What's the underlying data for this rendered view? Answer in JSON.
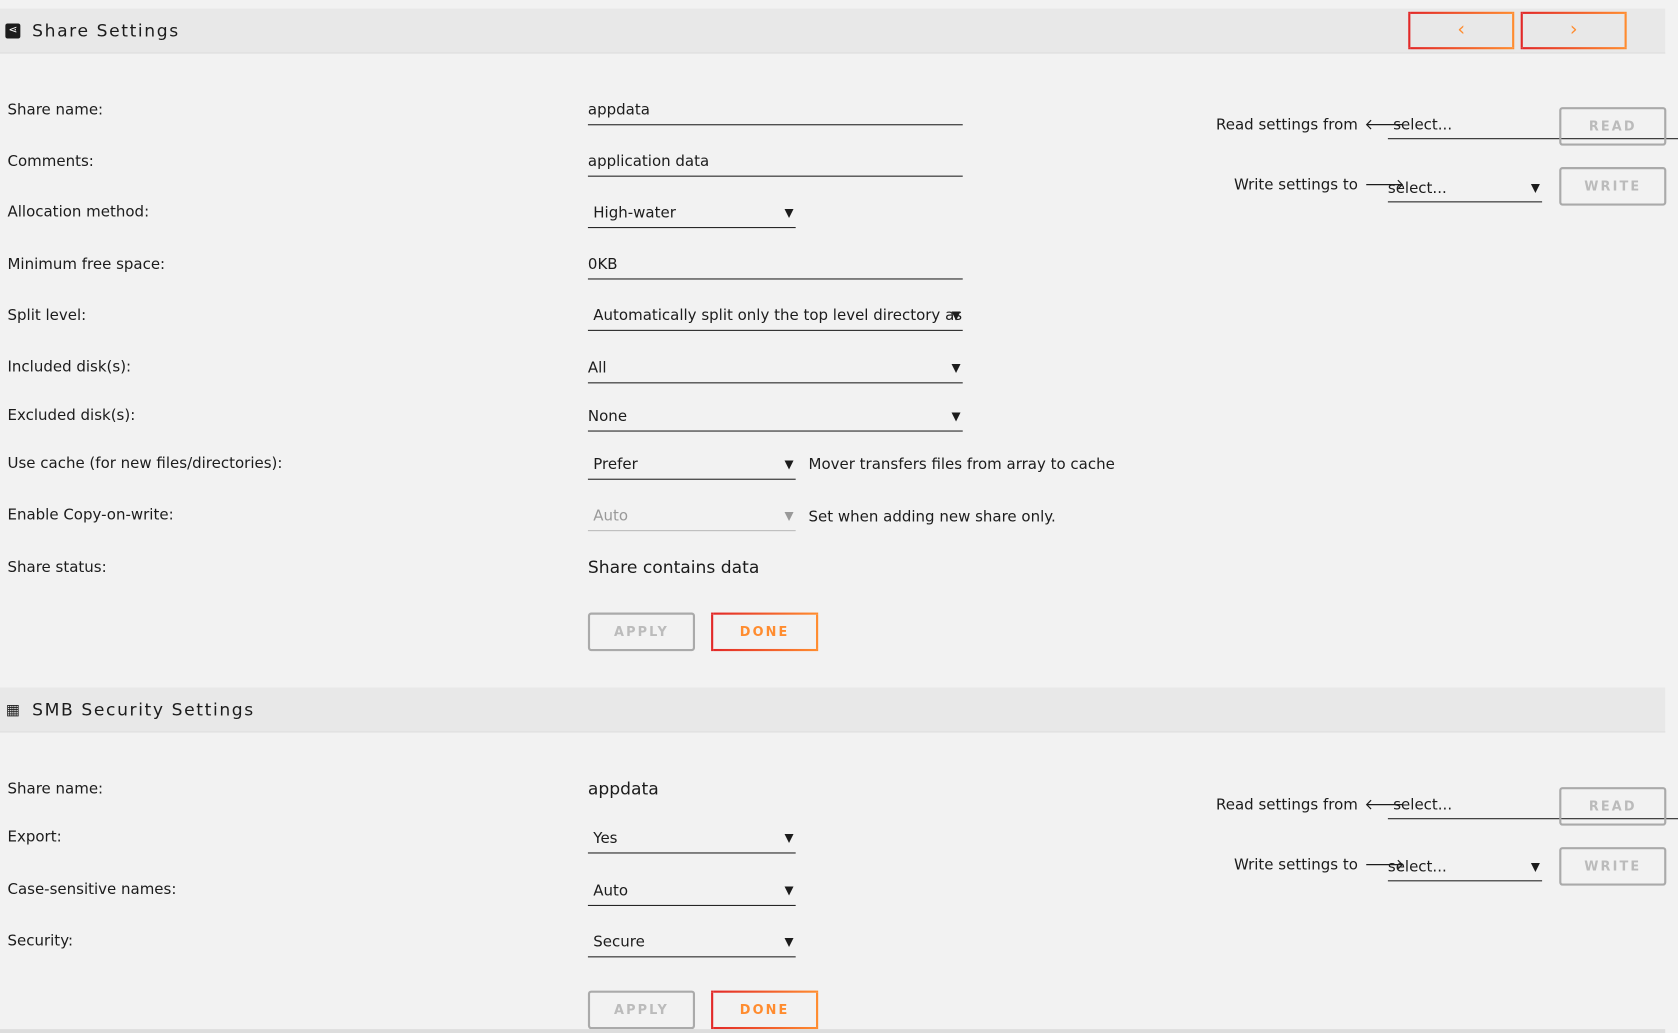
{
  "share_settings": {
    "title": "Share Settings",
    "icon": "share-icon",
    "prev_icon": "‹",
    "next_icon": "›",
    "fields": [
      {
        "label": "Share name:",
        "value": "appdata"
      },
      {
        "label": "Comments:",
        "value": "application data"
      },
      {
        "label": "Allocation method:",
        "value": "High-water"
      },
      {
        "label": "Minimum free space:",
        "value": "0KB"
      },
      {
        "label": "Split level:",
        "value": "Automatically split only the top level directory as"
      },
      {
        "label": "Included disk(s):",
        "value": "All"
      },
      {
        "label": "Excluded disk(s):",
        "value": "None"
      },
      {
        "label": "Use cache (for new files/directories):",
        "value": "Prefer",
        "note": "Mover transfers files from array to cache"
      },
      {
        "label": "Enable Copy-on-write:",
        "value": "Auto",
        "note": "Set when adding new share only."
      },
      {
        "label": "Share status:",
        "value": "Share contains data"
      }
    ],
    "read_label": "Read settings from",
    "read_placeholder": "select...",
    "read_button": "READ",
    "write_label": "Write settings to",
    "write_placeholder": "select...",
    "write_button": "WRITE",
    "apply": "APPLY",
    "done": "DONE"
  },
  "smb": {
    "title": "SMB Security Settings",
    "icon": "windows-icon",
    "fields": [
      {
        "label": "Share name:",
        "value": "appdata"
      },
      {
        "label": "Export:",
        "value": "Yes"
      },
      {
        "label": "Case-sensitive names:",
        "value": "Auto"
      },
      {
        "label": "Security:",
        "value": "Secure"
      }
    ],
    "read_label": "Read settings from",
    "read_placeholder": "select...",
    "read_button": "READ",
    "write_label": "Write settings to",
    "write_placeholder": "select...",
    "write_button": "WRITE",
    "apply": "APPLY",
    "done": "DONE"
  },
  "colors": {
    "accent_start": "#e22828",
    "accent_end": "#ff8c2f"
  }
}
